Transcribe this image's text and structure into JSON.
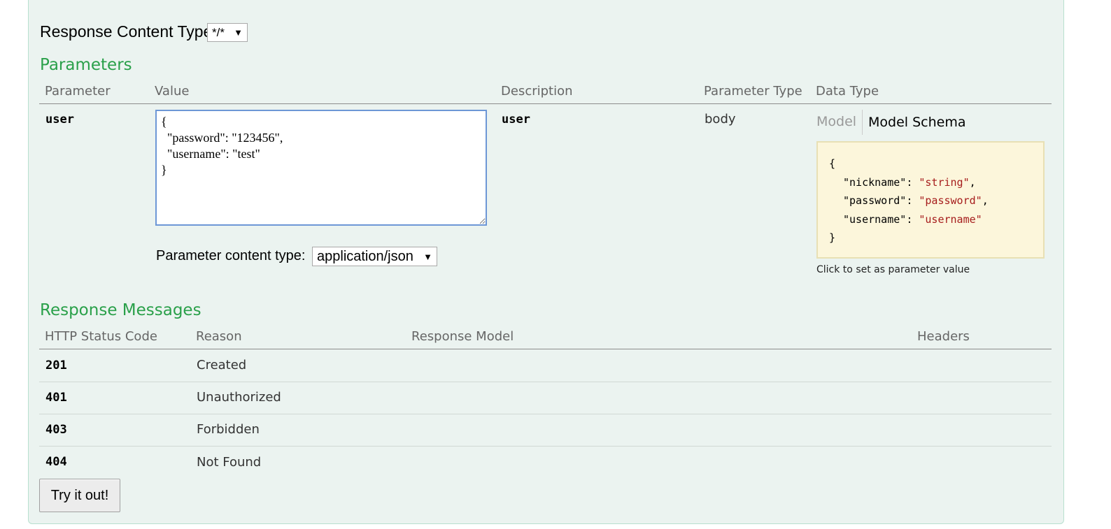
{
  "response_content_type": {
    "label": "Response Content Type",
    "selected": "*/*"
  },
  "parameters": {
    "title": "Parameters",
    "headers": {
      "parameter": "Parameter",
      "value": "Value",
      "description": "Description",
      "parameter_type": "Parameter Type",
      "data_type": "Data Type"
    },
    "row": {
      "name": "user",
      "value": "{\n  \"password\": \"123456\",\n  \"username\": \"test\"\n}",
      "description": "user",
      "parameter_type": "body",
      "content_type_label": "Parameter content type:",
      "content_type_selected": "application/json",
      "data_type_tabs": [
        "Model",
        "Model Schema"
      ],
      "schema": {
        "open": "{",
        "lines": [
          {
            "key": "\"nickname\"",
            "value": "\"string\"",
            "comma": ","
          },
          {
            "key": "\"password\"",
            "value": "\"password\"",
            "comma": ","
          },
          {
            "key": "\"username\"",
            "value": "\"username\"",
            "comma": ""
          }
        ],
        "close": "}"
      },
      "schema_hint": "Click to set as parameter value"
    }
  },
  "response_messages": {
    "title": "Response Messages",
    "headers": {
      "status": "HTTP Status Code",
      "reason": "Reason",
      "model": "Response Model",
      "headers": "Headers"
    },
    "rows": [
      {
        "code": "201",
        "reason": "Created"
      },
      {
        "code": "401",
        "reason": "Unauthorized"
      },
      {
        "code": "403",
        "reason": "Forbidden"
      },
      {
        "code": "404",
        "reason": "Not Found"
      }
    ]
  },
  "actions": {
    "try_label": "Try it out!"
  },
  "icons": {
    "dropdown_arrow": "▼"
  },
  "colors": {
    "section_title": "#2aa04a",
    "panel_bg": "#ebf3f0",
    "schema_bg": "#fcf6db",
    "schema_string": "#a61d1d",
    "textarea_border": "#6d97d6"
  }
}
